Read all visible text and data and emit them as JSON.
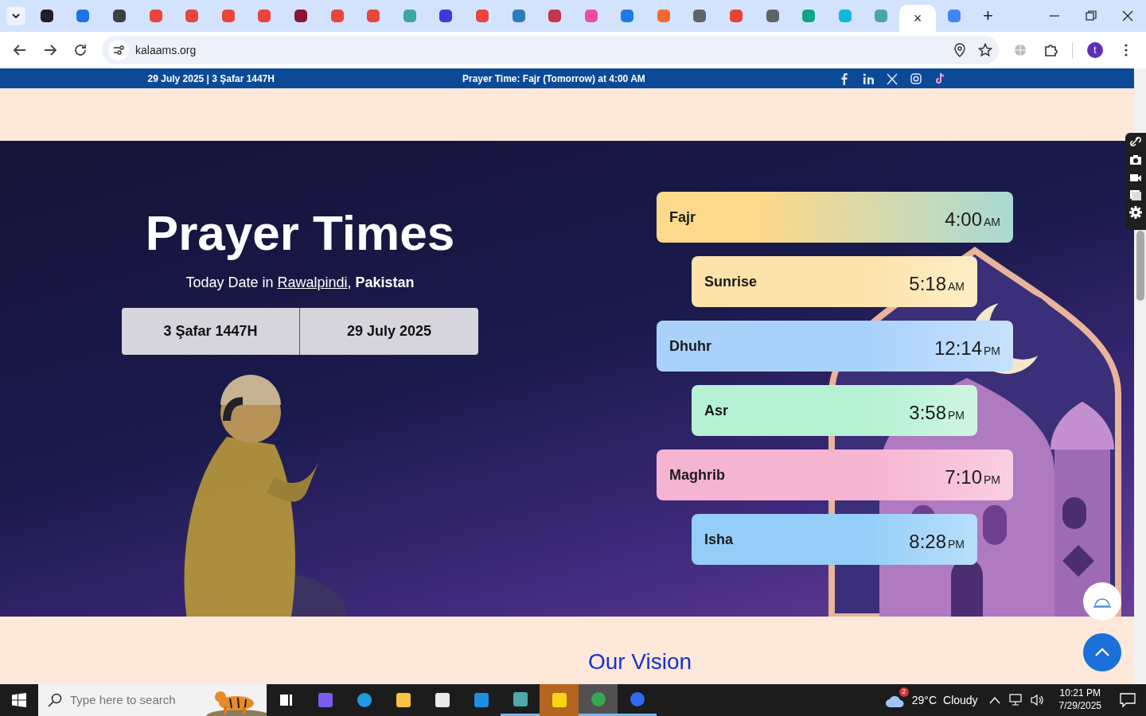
{
  "browser": {
    "tabs": [
      {
        "color": "#202124",
        "selected": false
      },
      {
        "color": "#1a73e8",
        "selected": false
      },
      {
        "color": "#3c4043",
        "selected": false
      },
      {
        "color": "#e8453c",
        "selected": false
      },
      {
        "color": "#e8453c",
        "selected": false
      },
      {
        "color": "#e8453c",
        "selected": false
      },
      {
        "color": "#e8453c",
        "selected": false
      },
      {
        "color": "#8a1538",
        "selected": false
      },
      {
        "color": "#e8453c",
        "selected": false
      },
      {
        "color": "#e8453c",
        "selected": false
      },
      {
        "color": "#3aa6a6",
        "selected": false
      },
      {
        "color": "#3b3bdc",
        "selected": false
      },
      {
        "color": "#e8453c",
        "selected": false
      },
      {
        "color": "#2a7bbf",
        "selected": false
      },
      {
        "color": "#c2364f",
        "selected": false
      },
      {
        "color": "#ef4f9a",
        "selected": false
      },
      {
        "color": "#1e7be6",
        "selected": false
      },
      {
        "color": "#f26a2e",
        "selected": false
      },
      {
        "color": "#5f6368",
        "selected": false
      },
      {
        "color": "#ea4335",
        "selected": false
      },
      {
        "color": "#5f6368",
        "selected": false
      },
      {
        "color": "#11a683",
        "selected": false
      },
      {
        "color": "#12b7e0",
        "selected": false
      },
      {
        "color": "#4aa6a6",
        "selected": false
      },
      {
        "selected": true,
        "close": "×"
      },
      {
        "color": "#4285f4",
        "selected": false
      }
    ],
    "new_tab": "+",
    "address": "kalaams.org",
    "profile_initial": "t"
  },
  "topbar": {
    "date": "29 July 2025 | 3 Şafar 1447H",
    "notice": "Prayer Time: **Fajr (Tomorrow)** at 4:00 AM"
  },
  "hero": {
    "title": "Prayer Times",
    "subtitle_prefix": "Today Date in",
    "city": "Rawalpindi",
    "separator": ",",
    "country": "Pakistan",
    "hijri_date": "3 Şafar 1447H",
    "gregorian_date": "29 July 2025",
    "prayers": [
      {
        "name": "Fajr",
        "time": "4:00",
        "period": "AM",
        "color": "#fcd98b"
      },
      {
        "name": "Sunrise",
        "time": "5:18",
        "period": "AM",
        "color": "#fde3a9"
      },
      {
        "name": "Dhuhr",
        "time": "12:14",
        "period": "PM",
        "color": "#a9d2fb"
      },
      {
        "name": "Asr",
        "time": "3:58",
        "period": "PM",
        "color": "#b5f1d2"
      },
      {
        "name": "Maghrib",
        "time": "7:10",
        "period": "PM",
        "color": "#f6b4d3"
      },
      {
        "name": "Isha",
        "time": "8:28",
        "period": "PM",
        "color": "#94cdf8"
      }
    ]
  },
  "section_heading": "Our Vision",
  "taskbar": {
    "search_placeholder": "Type here to search",
    "apps": [
      {
        "color": "#ffffff",
        "running": false,
        "selected": false,
        "flashing": false
      },
      {
        "color": "#7c5cf0",
        "running": false,
        "selected": false,
        "flashing": false
      },
      {
        "color": "#1f9be0",
        "running": false,
        "selected": false,
        "flashing": false
      },
      {
        "color": "#f5c242",
        "running": false,
        "selected": false,
        "flashing": false
      },
      {
        "color": "#e9e9e9",
        "running": false,
        "selected": false,
        "flashing": false
      },
      {
        "color": "#1b8fe0",
        "running": false,
        "selected": false,
        "flashing": false
      },
      {
        "color": "#4fa9a9",
        "running": true,
        "selected": false,
        "flashing": false
      },
      {
        "color": "#f7d417",
        "running": false,
        "selected": false,
        "flashing": true
      },
      {
        "color": "#34a853",
        "running": true,
        "selected": true,
        "flashing": false
      },
      {
        "color": "#2d6cf0",
        "running": true,
        "selected": false,
        "flashing": false
      }
    ],
    "weather_badge": "2",
    "temperature": "29°C",
    "condition": "Cloudy",
    "time": "10:21 PM",
    "date": "7/29/2025"
  }
}
